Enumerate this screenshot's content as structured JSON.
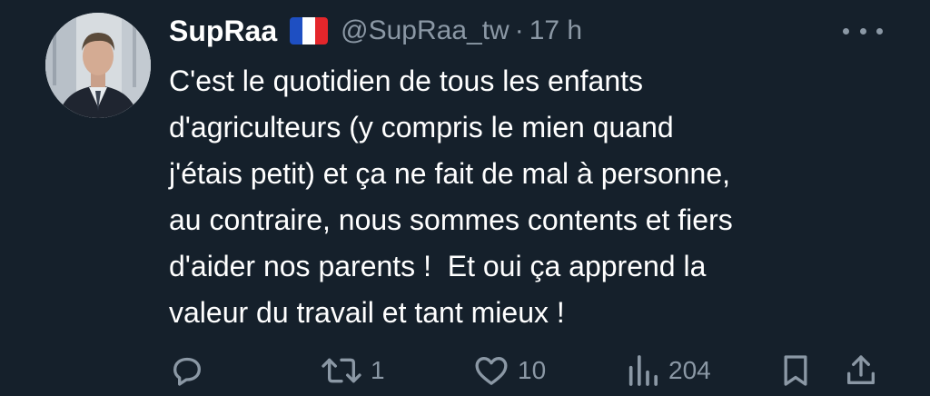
{
  "author": {
    "display_name": "SupRaa",
    "handle": "@SupRaa_tw",
    "separator": "·",
    "time": "17 h",
    "flag_icon": "france-flag-icon"
  },
  "tweet": {
    "text": "C'est le quotidien de tous les enfants\nd'agriculteurs (y compris le mien quand\nj'étais petit) et ça ne fait de mal à personne,\nau contraire, nous sommes contents et fiers\nd'aider nos parents !  Et oui ça apprend la\nvaleur du travail et tant mieux !"
  },
  "actions": {
    "reply_icon": "reply-icon",
    "retweet_icon": "retweet-icon",
    "retweet_count": "1",
    "like_icon": "heart-icon",
    "like_count": "10",
    "views_icon": "views-icon",
    "views_count": "204",
    "bookmark_icon": "bookmark-icon",
    "share_icon": "share-icon"
  },
  "colors": {
    "background": "#15202b",
    "text": "#ffffff",
    "muted": "#8b98a5",
    "flag_blue": "#1e4fc2",
    "flag_white": "#ffffff",
    "flag_red": "#e4262b"
  }
}
